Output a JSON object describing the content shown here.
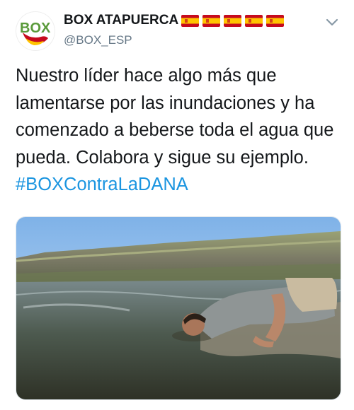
{
  "tweet": {
    "author_name": "BOX ATAPUERCA",
    "flag_icons": [
      "spain-flag-icon",
      "spain-flag-icon",
      "spain-flag-icon",
      "spain-flag-icon",
      "spain-flag-icon"
    ],
    "handle": "@BOX_ESP",
    "avatar_logo_text": "BOX",
    "text": "Nuestro líder hace algo más que lamentarse por las inundaciones y ha comenzado a beberse toda el agua que pueda. Colabora y sigue su ejemplo. ",
    "hashtag": "#BOXContraLaDANA",
    "menu_icon": "chevron-down-icon"
  },
  "colors": {
    "text": "#14171a",
    "secondary": "#657786",
    "link": "#1b95e0",
    "flag_red": "#c60b1e",
    "flag_yellow": "#ffc400",
    "logo_green": "#5a9a3a"
  }
}
